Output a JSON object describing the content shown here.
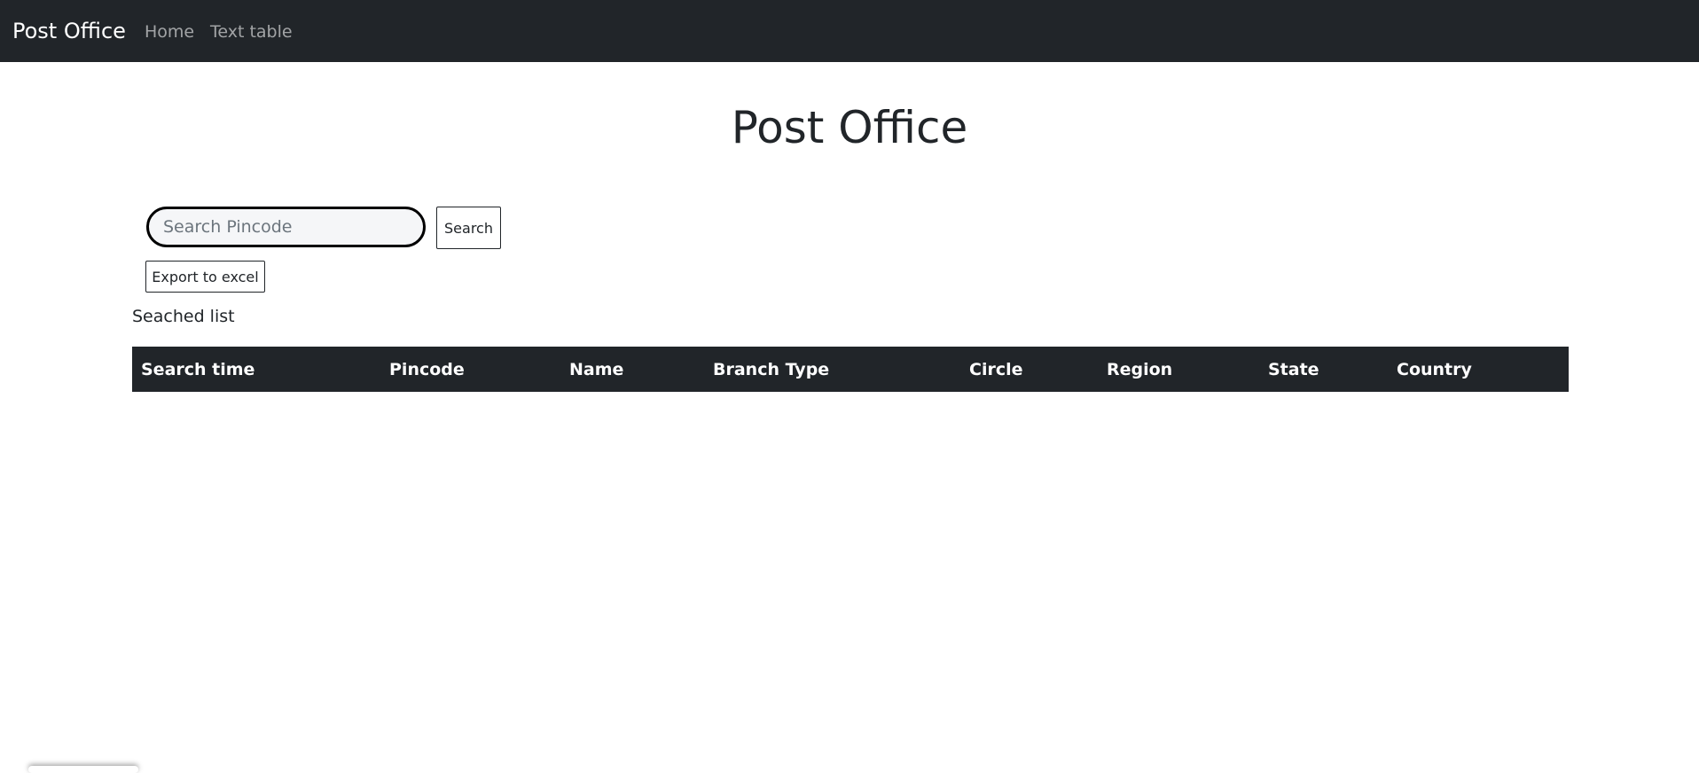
{
  "navbar": {
    "brand": "Post Office",
    "links": [
      "Home",
      "Text table"
    ]
  },
  "page": {
    "title": "Post Office"
  },
  "search": {
    "placeholder": "Search Pincode",
    "value": "",
    "button_label": "Search"
  },
  "export": {
    "button_label": "Export to excel"
  },
  "list": {
    "label": "Seached list"
  },
  "table": {
    "headers": [
      "Search time",
      "Pincode",
      "Name",
      "Branch Type",
      "Circle",
      "Region",
      "State",
      "Country"
    ],
    "rows": []
  },
  "colors": {
    "navbar_bg": "#212529",
    "table_header_bg": "#212529",
    "input_bg": "#f5f6f8"
  }
}
